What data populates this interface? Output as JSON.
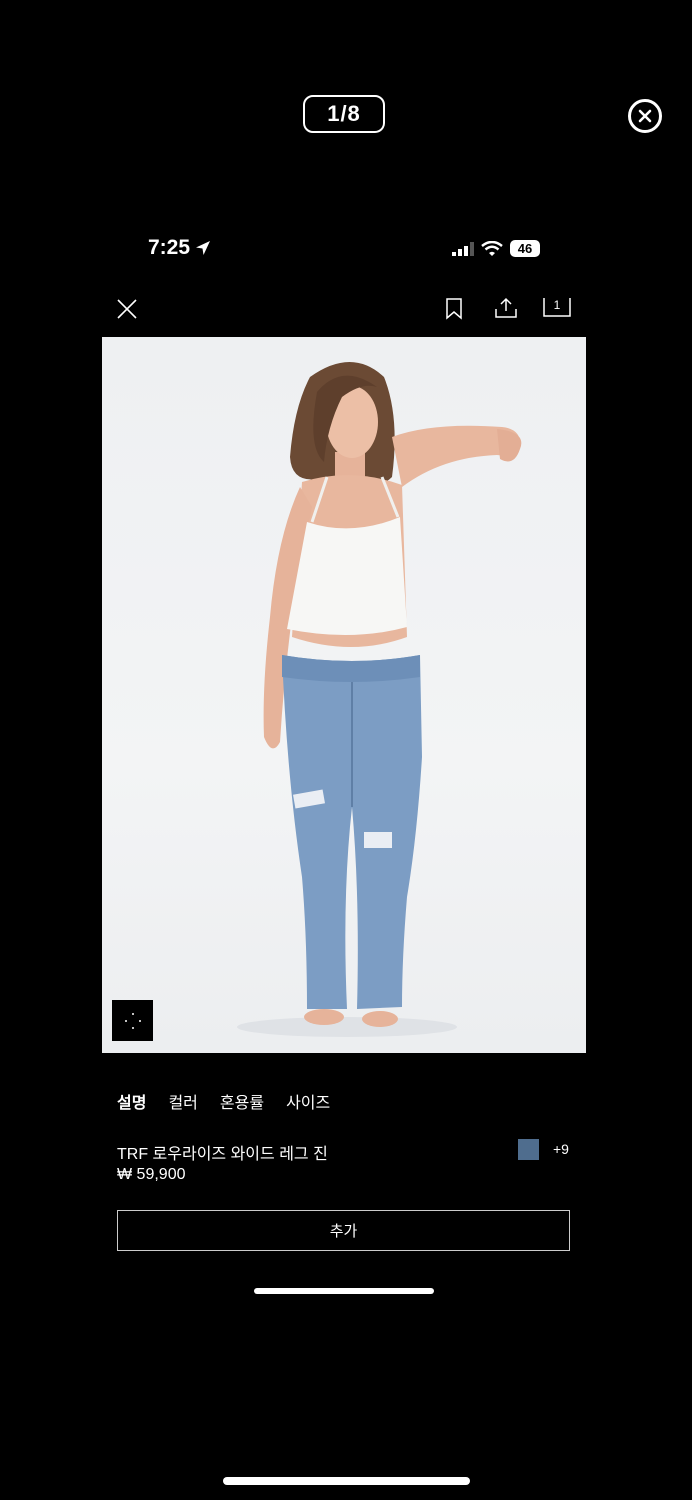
{
  "viewer": {
    "counter": "1/8",
    "close_icon": "close-circle-icon"
  },
  "status_bar": {
    "time": "7:25",
    "battery": "46",
    "icons": [
      "location-arrow-icon",
      "signal-icon",
      "wifi-icon",
      "battery-icon"
    ]
  },
  "toolbar": {
    "icons": [
      "close-icon",
      "bookmark-icon",
      "share-icon",
      "cart-icon"
    ],
    "cart_count": "1"
  },
  "product": {
    "tabs": [
      {
        "label": "설명",
        "active": true
      },
      {
        "label": "컬러",
        "active": false
      },
      {
        "label": "혼용률",
        "active": false
      },
      {
        "label": "사이즈",
        "active": false
      }
    ],
    "name": "TRF 로우라이즈 와이드 레그 진",
    "price": "₩ 59,900",
    "swatch_color": "#4f6d8e",
    "more_colors": "+9",
    "add_button": "추가"
  }
}
